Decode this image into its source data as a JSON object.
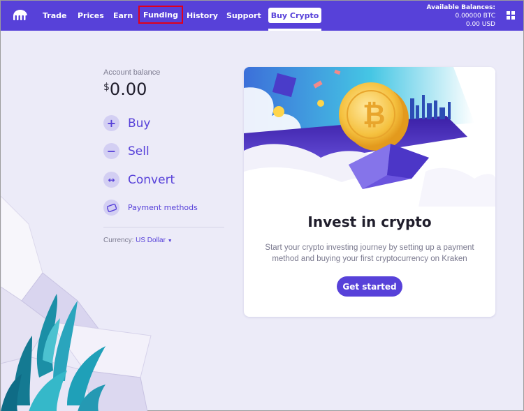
{
  "nav": {
    "items": [
      {
        "label": "Trade"
      },
      {
        "label": "Prices"
      },
      {
        "label": "Earn"
      },
      {
        "label": "Funding"
      },
      {
        "label": "History"
      },
      {
        "label": "Support"
      }
    ],
    "buy_crypto_label": "Buy Crypto",
    "balances": {
      "title": "Available Balances:",
      "btc": "0.00000 BTC",
      "usd": "0.00 USD"
    },
    "highlight_color": "#e0001b"
  },
  "account": {
    "label": "Account balance",
    "currency_symbol": "$",
    "value": "0.00"
  },
  "actions": [
    {
      "label": "Buy",
      "icon": "plus-icon"
    },
    {
      "label": "Sell",
      "icon": "minus-icon"
    },
    {
      "label": "Convert",
      "icon": "swap-icon"
    }
  ],
  "payment_methods": {
    "label": "Payment methods",
    "icon": "card-icon"
  },
  "currency": {
    "label": "Currency:",
    "value": "US Dollar"
  },
  "card": {
    "title": "Invest in crypto",
    "description": "Start your crypto investing journey by setting up a payment method and buying your first cryptocurrency on Kraken",
    "cta_label": "Get started"
  },
  "colors": {
    "brand": "#5741d9",
    "background": "#ecebf8"
  }
}
